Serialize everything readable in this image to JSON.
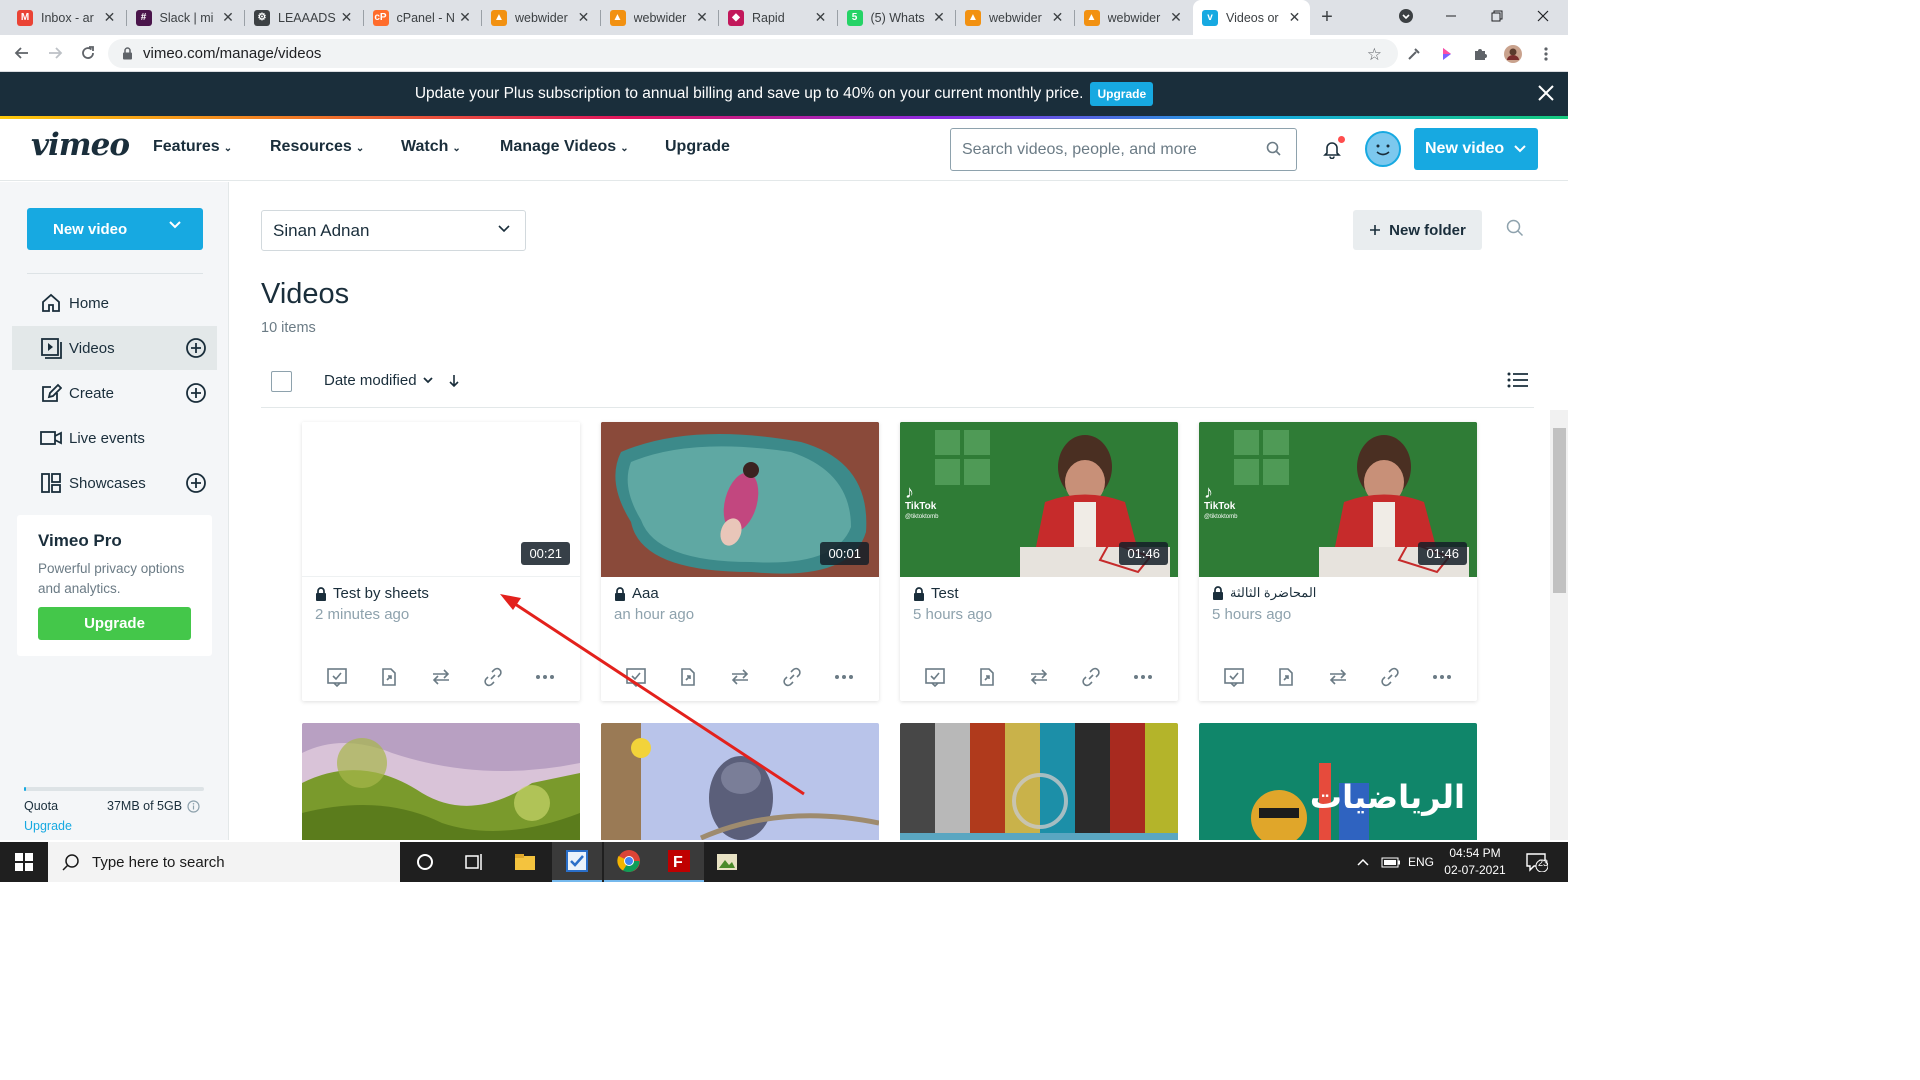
{
  "browser": {
    "tabs": [
      {
        "title": "Inbox - ar",
        "icon": "gmail-icon",
        "color": "#ea4335",
        "glyph": "M"
      },
      {
        "title": "Slack | mi",
        "icon": "slack-icon",
        "color": "#4a154b",
        "glyph": "#"
      },
      {
        "title": "LEAAADS",
        "icon": "bot-icon",
        "color": "#3c4043",
        "glyph": "⚙"
      },
      {
        "title": "cPanel - N",
        "icon": "cpanel-icon",
        "color": "#ff6c2c",
        "glyph": "cP"
      },
      {
        "title": "webwider",
        "icon": "phpmyadmin-icon",
        "color": "#f29111",
        "glyph": "▲"
      },
      {
        "title": "webwider",
        "icon": "phpmyadmin-icon",
        "color": "#f29111",
        "glyph": "▲"
      },
      {
        "title": "Rapid",
        "icon": "rapid-icon",
        "color": "#c2185b",
        "glyph": "◆"
      },
      {
        "title": "(5) Whats",
        "icon": "whatsapp-icon",
        "color": "#25d366",
        "glyph": "5"
      },
      {
        "title": "webwider",
        "icon": "phpmyadmin-icon",
        "color": "#f29111",
        "glyph": "▲"
      },
      {
        "title": "webwider",
        "icon": "phpmyadmin-icon",
        "color": "#f29111",
        "glyph": "▲"
      },
      {
        "title": "Videos or",
        "icon": "vimeo-icon",
        "color": "#17a9e1",
        "glyph": "v",
        "active": true
      }
    ],
    "url": "vimeo.com/manage/videos"
  },
  "promo": {
    "text": "Update your Plus subscription to annual billing and save up to 40% on your current monthly price.",
    "button": "Upgrade"
  },
  "header": {
    "logo": "vimeo",
    "menu": [
      "Features",
      "Resources",
      "Watch",
      "Manage Videos",
      "Upgrade"
    ],
    "search_placeholder": "Search videos, people, and more",
    "new_video": "New video"
  },
  "sidebar": {
    "new_video": "New video",
    "items": [
      {
        "label": "Home",
        "icon": "home-icon"
      },
      {
        "label": "Videos",
        "icon": "videos-icon"
      },
      {
        "label": "Create",
        "icon": "create-icon"
      },
      {
        "label": "Live events",
        "icon": "camera-icon"
      },
      {
        "label": "Showcases",
        "icon": "showcases-icon"
      }
    ],
    "pro": {
      "title": "Vimeo Pro",
      "description": "Powerful privacy options and analytics.",
      "button": "Upgrade"
    },
    "quota": {
      "label": "Quota",
      "value": "37MB of 5GB",
      "used_fraction": 0.007,
      "upgrade": "Upgrade"
    }
  },
  "main": {
    "owner": "Sinan Adnan",
    "new_folder": "New folder",
    "title": "Videos",
    "count": "10 items",
    "sort_label": "Date modified",
    "videos": [
      {
        "title": "Test by sheets",
        "time": "2 minutes ago",
        "duration": "00:21"
      },
      {
        "title": "Aaa",
        "time": "an hour ago",
        "duration": "00:01"
      },
      {
        "title": "Test",
        "time": "5 hours ago",
        "duration": "01:46"
      },
      {
        "title": "المحاضرة الثالثة",
        "time": "5 hours ago",
        "duration": "01:46"
      }
    ],
    "thumb_text": {
      "tiktok": "TikTok",
      "tiktok_handle": "@tiktoktomb",
      "arabic": "الرياضيات"
    }
  },
  "taskbar": {
    "search_placeholder": "Type here to search",
    "language": "ENG",
    "time": "04:54 PM",
    "date": "02-07-2021",
    "notifications": "23"
  }
}
